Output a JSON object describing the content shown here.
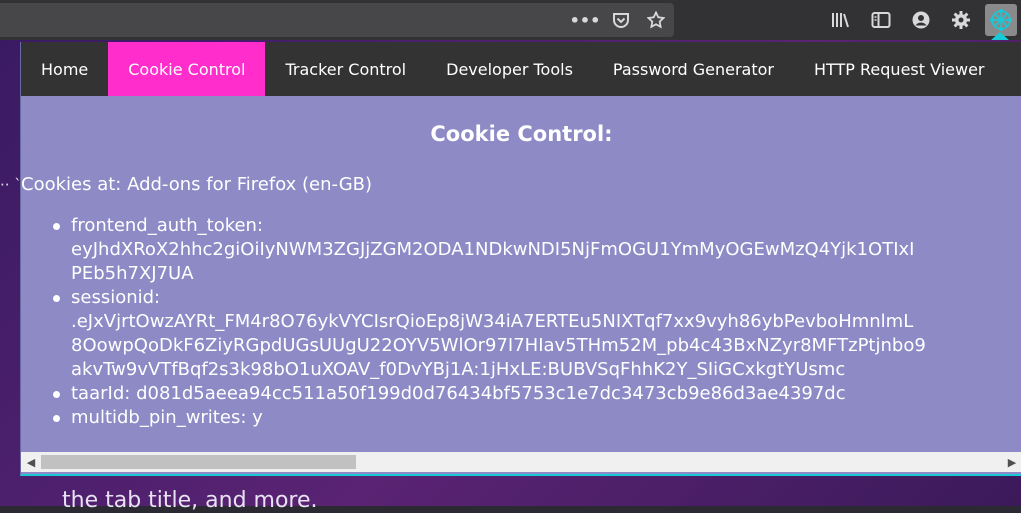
{
  "toolbar": {
    "icons": {
      "more": "•••",
      "pocket": "pocket-icon",
      "bookmark": "star-icon",
      "library": "library-icon",
      "sidebar": "sidebar-icon",
      "account": "account-icon",
      "settings": "gear-icon",
      "extension": "extension-network-icon"
    }
  },
  "nav": {
    "items": [
      {
        "label": "Home"
      },
      {
        "label": "Cookie Control"
      },
      {
        "label": "Tracker Control"
      },
      {
        "label": "Developer Tools"
      },
      {
        "label": "Password Generator"
      },
      {
        "label": "HTTP Request Viewer"
      }
    ],
    "active_index": 1
  },
  "content": {
    "heading": "Cookie Control:",
    "site_line": "Cookies at: Add-ons for Firefox (en-GB)",
    "cookies": [
      {
        "name": "frontend_auth_token:",
        "value_lines": [
          "eyJhdXRoX2hhc2giOiIyNWM3ZGJjZGM2ODA1NDkwNDI5NjFmOGU1YmMyOGEwMzQ4Yjk1OTIxI",
          "PEb5h7XJ7UA"
        ]
      },
      {
        "name": "sessionid:",
        "value_lines": [
          ".eJxVjrtOwzAYRt_FM4r8O76ykVYCIsrQioEp8jW34iA7ERTEu5NIXTqf7xx9vyh86ybPevboHmnlmL",
          "8OowpQoDkF6ZiyRGpdUGsUUgU22OYV5WlOr97I7HIav5THm52M_pb4c43BxNZyr8MFTzPtjnbo9",
          "akvTw9vVTfBqf2s3k98bO1uXOAV_f0DvYBj1A:1jHxLE:BUBVSqFhhK2Y_SIiGCxkgtYUsmc"
        ]
      },
      {
        "name": "taarId:",
        "value_lines": [
          "d081d5aeea94cc511a50f199d0d76434bf5753c1e7dc3473cb9e86d3ae4397dc"
        ]
      },
      {
        "name": "multidb_pin_writes:",
        "value_lines": [
          "y"
        ]
      }
    ]
  },
  "page": {
    "left_fragment": "·· `",
    "bottom_text": "the tab title, and more."
  },
  "colors": {
    "accent": "#ff2dcb",
    "popup_bg": "#8d8ac6",
    "nav_bg": "#333333",
    "ext_marker": "#18c9d6"
  }
}
